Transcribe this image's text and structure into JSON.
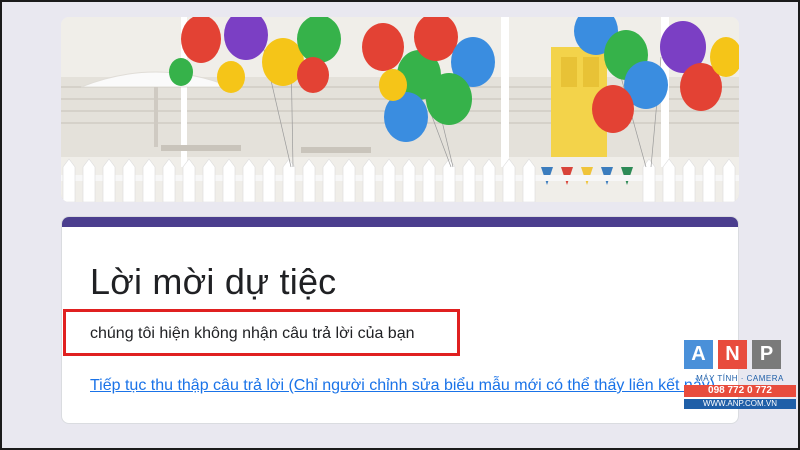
{
  "form": {
    "title": "Lời mời dự tiệc",
    "closed_message": "chúng tôi hiện không nhận câu trả lời của bạn",
    "reopen_link": "Tiếp tục thu thập câu trả lời (Chỉ người chỉnh sửa biểu mẫu mới có thể thấy liên kết này)",
    "accent_color": "#4b3e8e",
    "link_color": "#1a73e8"
  },
  "annotation": {
    "color": "#e02020"
  },
  "watermark": {
    "letters": [
      "A",
      "N",
      "P"
    ],
    "tagline": "MÁY TÍNH · CAMERA",
    "phone": "098 772 0 772",
    "url": "WWW.ANP.COM.VN"
  },
  "banner": {
    "icon": "party-balloons-image"
  }
}
